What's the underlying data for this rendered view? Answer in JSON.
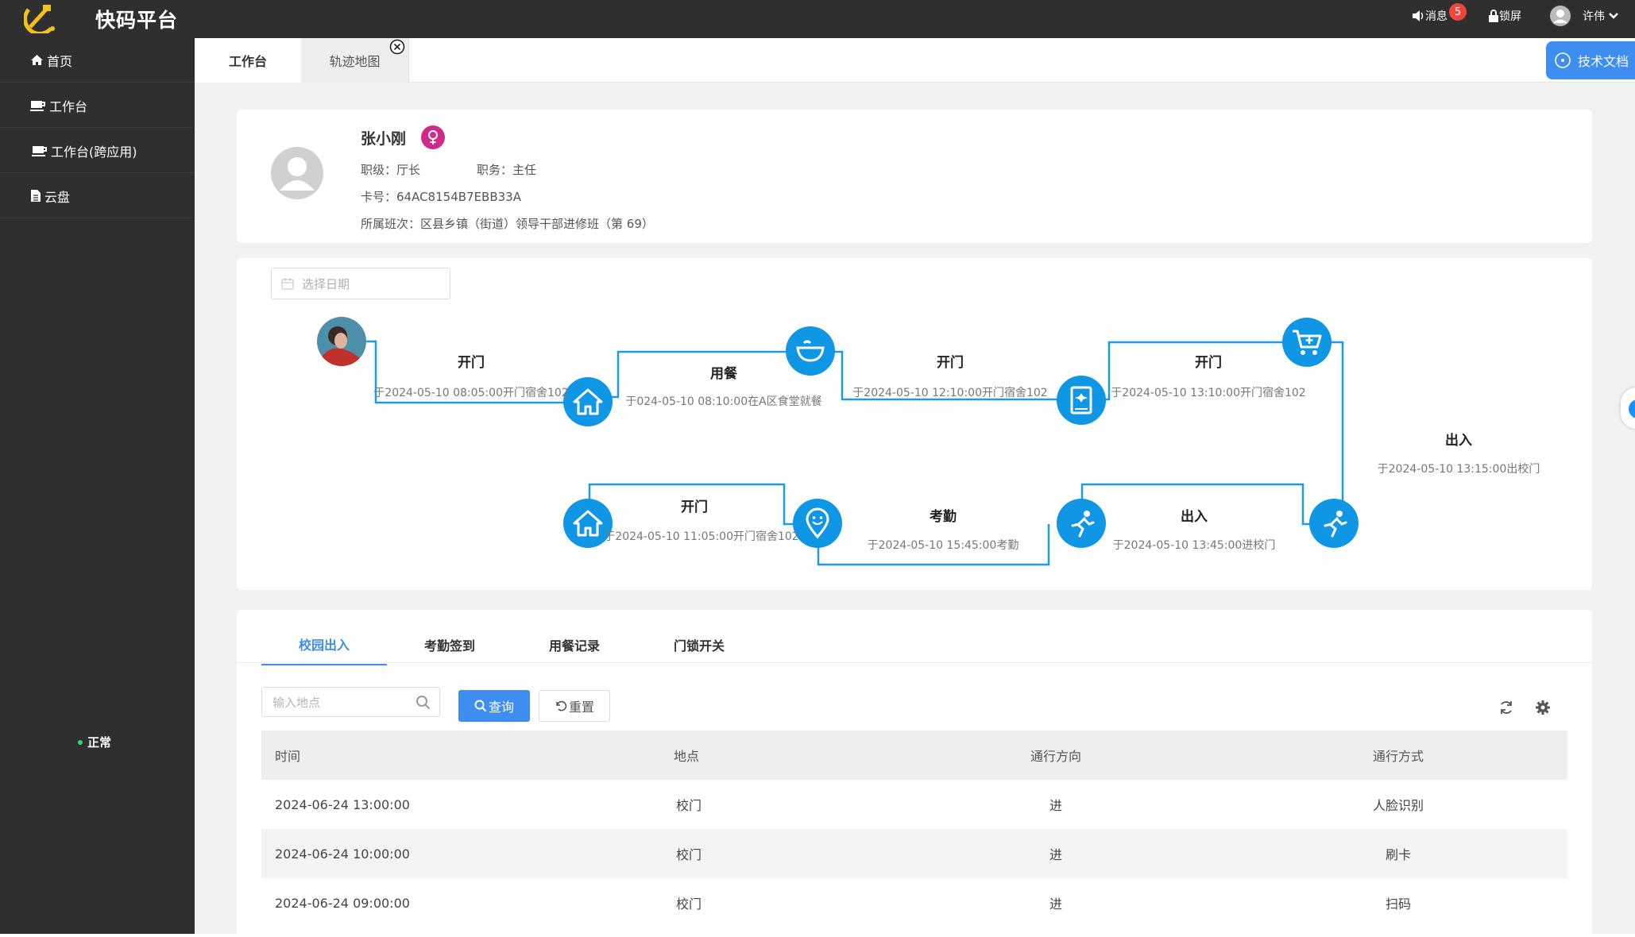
{
  "app": {
    "title": "快码平台",
    "messages_label": "消息",
    "messages_count": "5",
    "lock_label": "锁屏",
    "user_name": "许伟"
  },
  "sidebar": {
    "items": [
      {
        "label": "首页",
        "icon": "home-icon"
      },
      {
        "label": "工作台",
        "icon": "coffee-icon"
      },
      {
        "label": "工作台(跨应用)",
        "icon": "coffee-icon"
      },
      {
        "label": "云盘",
        "icon": "file-icon"
      }
    ],
    "status": "正常"
  },
  "tabs": {
    "items": [
      "工作台",
      "轨迹地图"
    ],
    "doc_button": "技术文档"
  },
  "profile": {
    "name": "张小刚",
    "gender_icon": "female-icon",
    "rank_label": "职级：厅长",
    "position_label": "职务：主任",
    "card_label": "卡号：64AC8154B7EBB33A",
    "class_label": "所属班次：区县乡镇（街道）领导干部进修班（第 69）"
  },
  "trajectory": {
    "date_placeholder": "选择日期",
    "events": [
      {
        "title": "开门",
        "desc": "于2024-05-10  08:05:00开门宿舍102"
      },
      {
        "title": "用餐",
        "desc": "于024-05-10  08:10:00在A区食堂就餐"
      },
      {
        "title": "开门",
        "desc": "于2024-05-10  12:10:00开门宿舍102"
      },
      {
        "title": "开门",
        "desc": "于2024-05-10  13:10:00开门宿舍102"
      },
      {
        "title": "出入",
        "desc": "于2024-05-10  13:15:00出校门"
      },
      {
        "title": "出入",
        "desc": "于2024-05-10  13:45:00进校门"
      },
      {
        "title": "考勤",
        "desc": "于2024-05-10  15:45:00考勤"
      },
      {
        "title": "开门",
        "desc": "于2024-05-10  11:05:00开门宿舍102"
      }
    ],
    "node_icons": [
      "home-icon",
      "bowl-icon",
      "book-icon",
      "cart-icon",
      "run-icon",
      "run-icon",
      "location-smile-icon",
      "home-icon"
    ],
    "accent_color": "#0f96e5"
  },
  "records": {
    "tabs": [
      "校园出入",
      "考勤签到",
      "用餐记录",
      "门锁开关"
    ],
    "active_tab": "校园出入",
    "search_placeholder": "输入地点",
    "query_button": "查询",
    "reset_button": "重置",
    "columns": [
      "时间",
      "地点",
      "通行方向",
      "通行方式"
    ],
    "rows": [
      [
        "2024-06-24 13:00:00",
        "校门",
        "进",
        "人脸识别"
      ],
      [
        "2024-06-24 10:00:00",
        "校门",
        "进",
        "刷卡"
      ],
      [
        "2024-06-24 09:00:00",
        "校门",
        "进",
        "扫码"
      ]
    ]
  }
}
